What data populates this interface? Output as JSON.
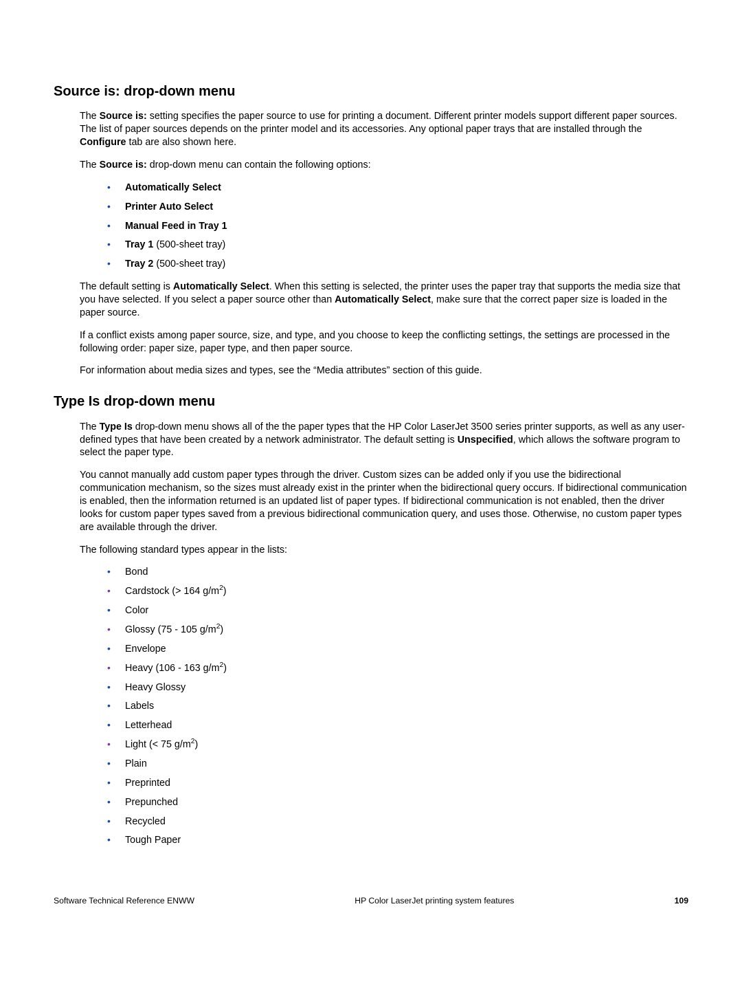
{
  "section1": {
    "heading": "Source is: drop-down menu",
    "p1_a": "The ",
    "p1_b": "Source is:",
    "p1_c": " setting specifies the paper source to use for printing a document. Different printer models support different paper sources. The list of paper sources depends on the printer model and its accessories. Any optional paper trays that are installed through the ",
    "p1_d": "Configure",
    "p1_e": " tab are also shown here.",
    "p2_a": "The ",
    "p2_b": "Source is:",
    "p2_c": " drop-down menu can contain the following options:",
    "options": [
      {
        "bold": "Automatically Select",
        "rest": ""
      },
      {
        "bold": "Printer Auto Select",
        "rest": ""
      },
      {
        "bold": "Manual Feed in Tray 1",
        "rest": ""
      },
      {
        "bold": "Tray 1",
        "rest": " (500-sheet tray)"
      },
      {
        "bold": "Tray 2",
        "rest": " (500-sheet tray)"
      }
    ],
    "p3_a": "The default setting is ",
    "p3_b": "Automatically Select",
    "p3_c": ". When this setting is selected, the printer uses the paper tray that supports the media size that you have selected. If you select a paper source other than ",
    "p3_d": "Automatically Select",
    "p3_e": ", make sure that the correct paper size is loaded in the paper source.",
    "p4": "If a conflict exists among paper source, size, and type, and you choose to keep the conflicting settings, the settings are processed in the following order: paper size, paper type, and then paper source.",
    "p5": "For information about media sizes and types, see the “Media attributes” section of this guide."
  },
  "section2": {
    "heading": "Type Is drop-down menu",
    "p1_a": "The ",
    "p1_b": "Type Is",
    "p1_c": " drop-down menu shows all of the the paper types that the HP Color LaserJet 3500 series printer supports, as well as any user-defined types that have been created by a network administrator. The default setting is ",
    "p1_d": "Unspecified",
    "p1_e": ", which allows the software program to select the paper type.",
    "p2": "You cannot manually add custom paper types through the driver. Custom sizes can be added only if you use the bidirectional communication mechanism, so the sizes must already exist in the printer when the bidirectional query occurs. If bidirectional communication is enabled, then the information returned is an updated list of paper types. If bidirectional communication is not enabled, then the driver looks for custom paper types saved from a previous bidirectional communication query, and uses those. Otherwise, no custom paper types are available through the driver.",
    "p3": "The following standard types appear in the lists:",
    "types": [
      {
        "style": "blue",
        "pre": "Bond"
      },
      {
        "style": "purple",
        "pre": "Cardstock (> 164 g/m",
        "sup": "2",
        "post": ")"
      },
      {
        "style": "blue",
        "pre": "Color"
      },
      {
        "style": "purple",
        "pre": "Glossy (75 - 105 g/m",
        "sup": "2",
        "post": ")"
      },
      {
        "style": "blue",
        "pre": "Envelope"
      },
      {
        "style": "purple",
        "pre": "Heavy (106 - 163 g/m",
        "sup": "2",
        "post": ")"
      },
      {
        "style": "blue",
        "pre": "Heavy Glossy"
      },
      {
        "style": "blue",
        "pre": "Labels"
      },
      {
        "style": "blue",
        "pre": "Letterhead"
      },
      {
        "style": "purple",
        "pre": "Light (< 75 g/m",
        "sup": "2",
        "post": ")"
      },
      {
        "style": "blue",
        "pre": "Plain"
      },
      {
        "style": "blue",
        "pre": "Preprinted"
      },
      {
        "style": "blue",
        "pre": "Prepunched"
      },
      {
        "style": "blue",
        "pre": "Recycled"
      },
      {
        "style": "blue",
        "pre": "Tough Paper"
      }
    ]
  },
  "footer": {
    "left": "Software Technical Reference ENWW",
    "center": "HP Color LaserJet printing system features",
    "right": "109"
  }
}
